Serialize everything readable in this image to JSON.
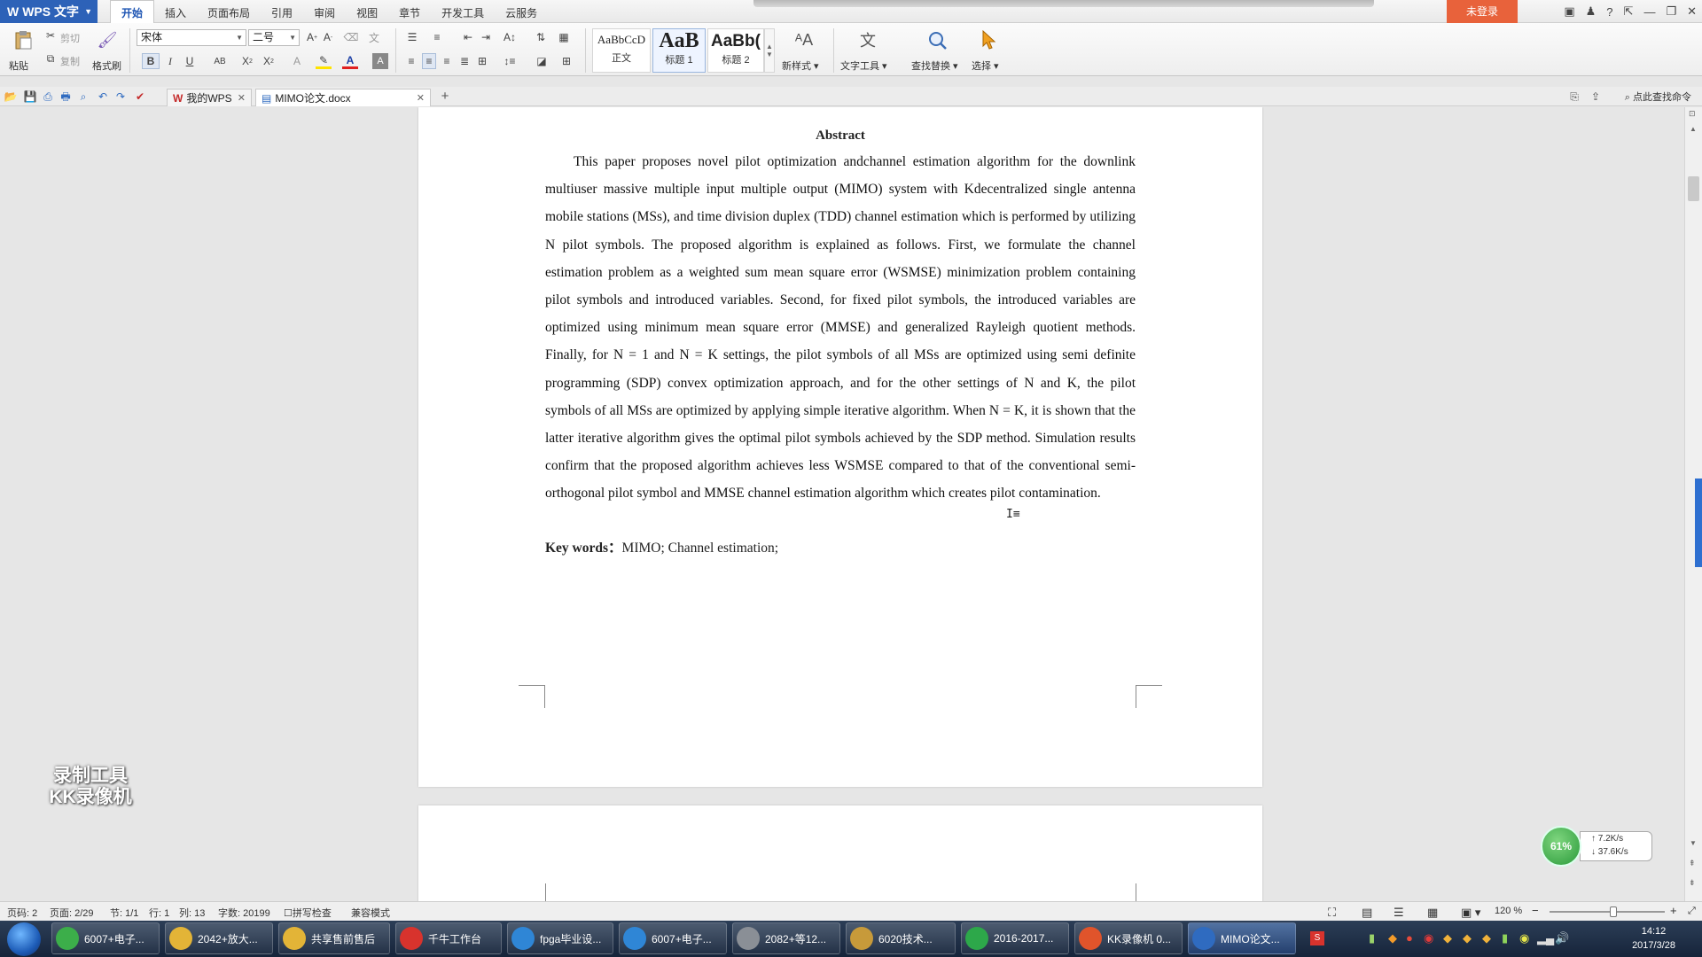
{
  "app": {
    "name": "WPS 文字"
  },
  "menu_tabs": [
    "开始",
    "插入",
    "页面布局",
    "引用",
    "审阅",
    "视图",
    "章节",
    "开发工具",
    "云服务"
  ],
  "login_button": "未登录",
  "ribbon": {
    "paste": "粘贴",
    "cut": "剪切",
    "copy": "复制",
    "format_painter": "格式刷",
    "font_name": "宋体",
    "font_size": "二号",
    "styles": [
      {
        "preview": "AaBbCcD",
        "name": "正文"
      },
      {
        "preview": "AaB",
        "name": "标题 1"
      },
      {
        "preview": "AaBb(",
        "name": "标题 2"
      }
    ],
    "new_style": "新样式",
    "text_tools": "文字工具",
    "find_replace": "查找替换",
    "select": "选择"
  },
  "doc_tabs": [
    {
      "label": "我的WPS",
      "active": false
    },
    {
      "label": "MIMO论文.docx",
      "active": true
    }
  ],
  "find_command": "点此查找命令",
  "document": {
    "title": "Abstract",
    "body": "This paper proposes novel pilot optimization andchannel estimation algorithm for the downlink multiuser massive multiple input multiple output (MIMO) system with Kdecentralized single antenna mobile stations (MSs), and time division duplex (TDD) channel estimation which is performed by utilizing N pilot symbols. The proposed algorithm is explained as follows. First, we formulate the channel estimation problem as a weighted sum mean square error (WSMSE) minimization problem containing pilot symbols and introduced variables. Second, for fixed pilot symbols, the introduced variables are optimized using minimum mean square error (MMSE) and generalized Rayleigh quotient methods. Finally, for N = 1 and N = K settings, the pilot symbols of all MSs are optimized using semi definite programming (SDP) convex optimization approach, and for the other settings of N and K, the pilot symbols of all MSs are optimized by applying simple iterative algorithm. When N = K, it is shown that the latter iterative algorithm gives the optimal pilot symbols achieved by the SDP method. Simulation results confirm that the proposed algorithm achieves less WSMSE compared to that of the conventional semi-orthogonal pilot symbol and MMSE channel estimation algorithm which creates pilot contamination.",
    "keywords_label": "Key words：",
    "keywords": "MIMO; Channel estimation;"
  },
  "status_bar": {
    "page_code": "页码: 2",
    "page": "页面: 2/29",
    "section": "节: 1/1",
    "row": "行: 1",
    "col": "列: 13",
    "word_count": "字数: 20199",
    "spell_check": "拼写检查",
    "compat_mode": "兼容模式",
    "zoom": "120 %",
    "zoom_fraction": 0.55
  },
  "taskbar": {
    "items": [
      {
        "label": "6007+电子...",
        "color": "#3cae4a"
      },
      {
        "label": "2042+放大...",
        "color": "#e3b437"
      },
      {
        "label": "共享售前售后",
        "color": "#e3b437"
      },
      {
        "label": "千牛工作台",
        "color": "#d8332d"
      },
      {
        "label": "fpga毕业设...",
        "color": "#2f86d6"
      },
      {
        "label": "6007+电子...",
        "color": "#2f86d6"
      },
      {
        "label": "2082+等12...",
        "color": "#8a8f96"
      },
      {
        "label": "6020技术...",
        "color": "#c79a3a"
      },
      {
        "label": "2016-2017...",
        "color": "#2da84a"
      },
      {
        "label": "KK录像机 0...",
        "color": "#e0542b"
      },
      {
        "label": "MIMO论文...",
        "color": "#2f6bc0"
      }
    ],
    "time": "14:12",
    "date": "2017/3/28"
  },
  "watermark": {
    "line1": "录制工具",
    "line2": "KK录像机"
  },
  "net_widget": {
    "percent": "61%",
    "up": "7.2K/s",
    "down": "37.6K/s"
  },
  "colors": {
    "accent": "#2d62b8",
    "login": "#e8623b",
    "page": "#ffffff",
    "workspace": "#e6e6e6"
  },
  "icons": [
    "paste-icon",
    "cut-icon",
    "copy-icon",
    "format-painter-icon",
    "bold-icon",
    "italic-icon",
    "underline-icon",
    "find-replace-icon",
    "select-arrow-icon",
    "new-style-icon",
    "text-tools-icon",
    "start-orb-icon",
    "volume-icon"
  ]
}
